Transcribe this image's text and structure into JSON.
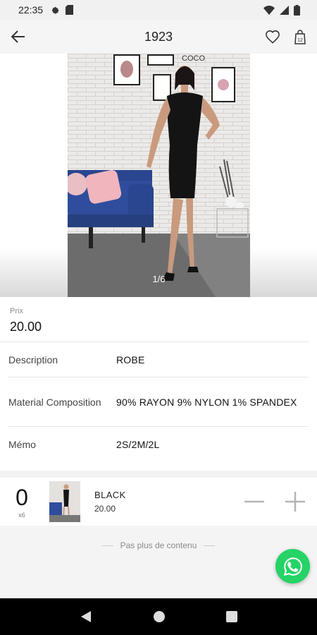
{
  "status_bar": {
    "time": "22:35"
  },
  "app_bar": {
    "title": "1923"
  },
  "gallery": {
    "indicator": "1/6",
    "sign_text": "COCO"
  },
  "product": {
    "price_label": "Prix",
    "price_value": "20.00",
    "rows": [
      {
        "key": "Description",
        "value": "ROBE"
      },
      {
        "key": "Material Composition",
        "value": "90% RAYON 9% NYLON 1% SPANDEX"
      },
      {
        "key": "Mémo",
        "value": "2S/2M/2L"
      }
    ]
  },
  "cart": {
    "quantity": "0",
    "quantity_sub": "x6",
    "variant_name": "BLACK",
    "variant_price": "20.00"
  },
  "footer": {
    "end_text": "Pas plus de contenu"
  },
  "colors": {
    "whatsapp": "#25d366",
    "nav_bar": "#000000",
    "sofa": "#2f4d9c"
  },
  "icons": [
    "back-arrow-icon",
    "heart-icon",
    "shopping-bag-icon",
    "minus-icon",
    "plus-icon",
    "whatsapp-icon",
    "nav-back-icon",
    "nav-home-icon",
    "nav-recents-icon"
  ]
}
